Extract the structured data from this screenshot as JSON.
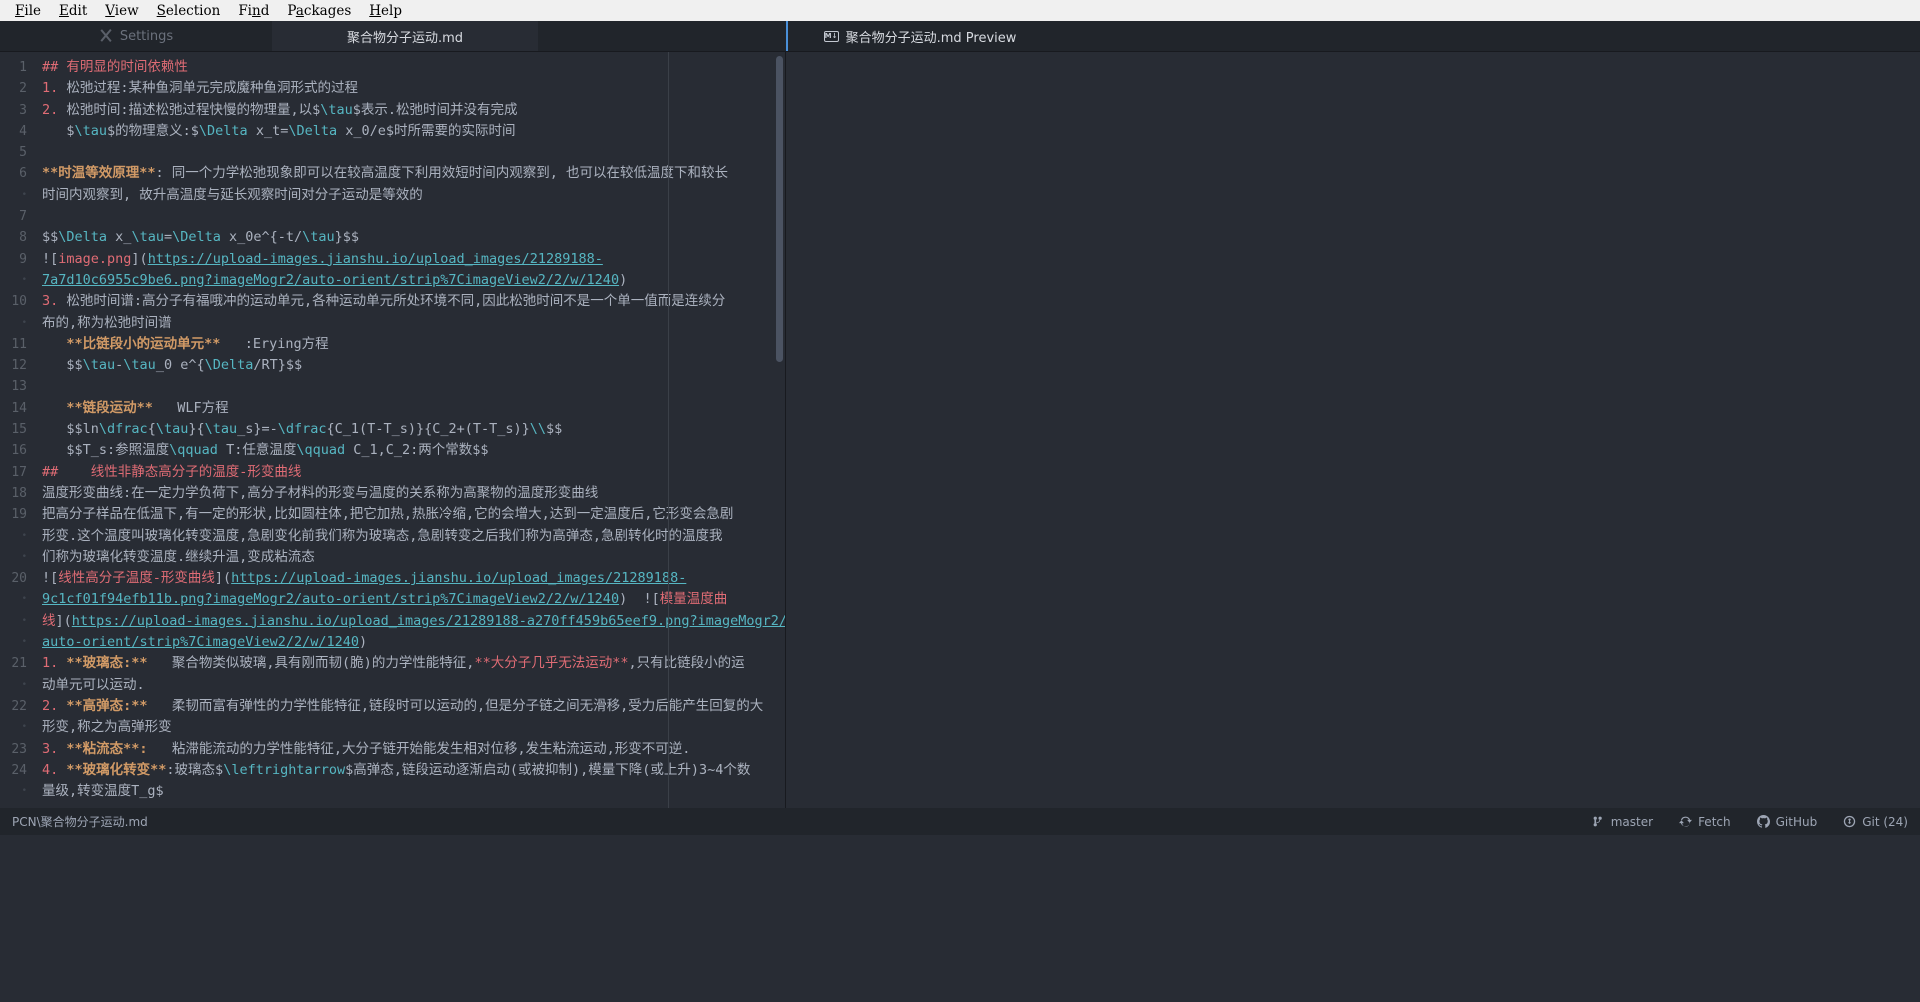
{
  "menubar": {
    "items": [
      {
        "pre": "",
        "mn": "F",
        "post": "ile"
      },
      {
        "pre": "",
        "mn": "E",
        "post": "dit"
      },
      {
        "pre": "",
        "mn": "V",
        "post": "iew"
      },
      {
        "pre": "",
        "mn": "S",
        "post": "election"
      },
      {
        "pre": "Fi",
        "mn": "n",
        "post": "d"
      },
      {
        "pre": "P",
        "mn": "a",
        "post": "ckages"
      },
      {
        "pre": "",
        "mn": "H",
        "post": "elp"
      }
    ]
  },
  "tabs": {
    "settings": {
      "label": "Settings",
      "icon": "wrench-icon"
    },
    "document": {
      "label": "聚合物分子运动.md"
    },
    "preview": {
      "label": "聚合物分子运动.md Preview",
      "icon": "markdown-icon",
      "badge": "M↓"
    }
  },
  "editor": {
    "lines": [
      {
        "num": "1",
        "soft": false,
        "segments": [
          {
            "t": "## ",
            "c": "c-head"
          },
          {
            "t": "有明显的时间依赖性",
            "c": "c-head"
          }
        ]
      },
      {
        "num": "2",
        "soft": false,
        "segments": [
          {
            "t": "1.",
            "c": "c-num"
          },
          {
            "t": " 松弛过程:某种鱼洞单元完成魔种鱼洞形式的过程",
            "c": "c-text"
          }
        ]
      },
      {
        "num": "3",
        "soft": false,
        "segments": [
          {
            "t": "2.",
            "c": "c-num"
          },
          {
            "t": " 松弛时间:描述松弛过程快慢的物理量,以$",
            "c": "c-text"
          },
          {
            "t": "\\tau",
            "c": "c-esc"
          },
          {
            "t": "$表示.松弛时间并没有完成",
            "c": "c-text"
          }
        ]
      },
      {
        "num": "4",
        "soft": false,
        "segments": [
          {
            "t": "   $",
            "c": "c-text"
          },
          {
            "t": "\\tau",
            "c": "c-esc"
          },
          {
            "t": "$的物理意义:$",
            "c": "c-text"
          },
          {
            "t": "\\Delta",
            "c": "c-esc"
          },
          {
            "t": " x_t=",
            "c": "c-text"
          },
          {
            "t": "\\Delta",
            "c": "c-esc"
          },
          {
            "t": " x_0/e$时所需要的实际时间",
            "c": "c-text"
          }
        ]
      },
      {
        "num": "5",
        "soft": false,
        "segments": []
      },
      {
        "num": "6",
        "soft": false,
        "segments": [
          {
            "t": "**时温等效原理**",
            "c": "c-bold"
          },
          {
            "t": ": 同一个力学松弛现象即可以在较高温度下利用效短时间内观察到, 也可以在较低温度下和较长",
            "c": "c-text"
          }
        ]
      },
      {
        "num": "•",
        "soft": true,
        "segments": [
          {
            "t": "时间内观察到, 故升高温度与延长观察时间对分子运动是等效的",
            "c": "c-text"
          }
        ]
      },
      {
        "num": "7",
        "soft": false,
        "segments": []
      },
      {
        "num": "8",
        "soft": false,
        "segments": [
          {
            "t": "$$",
            "c": "c-text"
          },
          {
            "t": "\\Delta",
            "c": "c-esc"
          },
          {
            "t": " x_",
            "c": "c-text"
          },
          {
            "t": "\\tau",
            "c": "c-esc"
          },
          {
            "t": "=",
            "c": "c-text"
          },
          {
            "t": "\\Delta",
            "c": "c-esc"
          },
          {
            "t": " x_0e^{-t/",
            "c": "c-text"
          },
          {
            "t": "\\tau",
            "c": "c-esc"
          },
          {
            "t": "}$$",
            "c": "c-text"
          }
        ]
      },
      {
        "num": "9",
        "soft": false,
        "segments": [
          {
            "t": "![",
            "c": "c-punct"
          },
          {
            "t": "image.png",
            "c": "c-linktxt"
          },
          {
            "t": "](",
            "c": "c-punct"
          },
          {
            "t": "https://upload-images.jianshu.io/upload_images/21289188-",
            "c": "c-link"
          }
        ]
      },
      {
        "num": "•",
        "soft": true,
        "segments": [
          {
            "t": "7a7d10c6955c9be6.png?imageMogr2/auto-orient/strip%7CimageView2/2/w/1240",
            "c": "c-link"
          },
          {
            "t": ")",
            "c": "c-punct"
          }
        ]
      },
      {
        "num": "10",
        "soft": false,
        "segments": [
          {
            "t": "3.",
            "c": "c-num"
          },
          {
            "t": " 松弛时间谱:高分子有福哦冲的运动单元,各种运动单元所处环境不同,因此松弛时间不是一个单一值而是连续分",
            "c": "c-text"
          }
        ]
      },
      {
        "num": "•",
        "soft": true,
        "segments": [
          {
            "t": "布的,称为松弛时间谱",
            "c": "c-text"
          }
        ]
      },
      {
        "num": "11",
        "soft": false,
        "segments": [
          {
            "t": "   **比链段小的运动单元**",
            "c": "c-bold"
          },
          {
            "t": "   :Erying方程",
            "c": "c-text"
          }
        ]
      },
      {
        "num": "12",
        "soft": false,
        "segments": [
          {
            "t": "   $$",
            "c": "c-text"
          },
          {
            "t": "\\tau",
            "c": "c-esc"
          },
          {
            "t": "-",
            "c": "c-text"
          },
          {
            "t": "\\tau",
            "c": "c-esc"
          },
          {
            "t": "_0 e^{",
            "c": "c-text"
          },
          {
            "t": "\\Delta",
            "c": "c-esc"
          },
          {
            "t": "/RT}$$",
            "c": "c-text"
          }
        ]
      },
      {
        "num": "13",
        "soft": false,
        "segments": []
      },
      {
        "num": "14",
        "soft": false,
        "segments": [
          {
            "t": "   **链段运动**",
            "c": "c-bold"
          },
          {
            "t": "   WLF方程",
            "c": "c-text"
          }
        ]
      },
      {
        "num": "15",
        "soft": false,
        "segments": [
          {
            "t": "   $$ln",
            "c": "c-text"
          },
          {
            "t": "\\dfrac",
            "c": "c-esc"
          },
          {
            "t": "{",
            "c": "c-text"
          },
          {
            "t": "\\tau",
            "c": "c-esc"
          },
          {
            "t": "}{",
            "c": "c-text"
          },
          {
            "t": "\\tau",
            "c": "c-esc"
          },
          {
            "t": "_s}=-",
            "c": "c-text"
          },
          {
            "t": "\\dfrac",
            "c": "c-esc"
          },
          {
            "t": "{C_1(T-T_s)}{C_2+(T-T_s)}",
            "c": "c-text"
          },
          {
            "t": "\\\\",
            "c": "c-esc"
          },
          {
            "t": "$$",
            "c": "c-text"
          }
        ]
      },
      {
        "num": "16",
        "soft": false,
        "segments": [
          {
            "t": "   $$T_s:参照温度",
            "c": "c-text"
          },
          {
            "t": "\\qquad",
            "c": "c-esc"
          },
          {
            "t": " T:任意温度",
            "c": "c-text"
          },
          {
            "t": "\\qquad",
            "c": "c-esc"
          },
          {
            "t": " C_1,C_2:两个常数$$",
            "c": "c-text"
          }
        ]
      },
      {
        "num": "17",
        "soft": false,
        "segments": [
          {
            "t": "##",
            "c": "c-head"
          },
          {
            "t": "    线性非静态高分子的温度-形变曲线",
            "c": "c-head"
          }
        ]
      },
      {
        "num": "18",
        "soft": false,
        "segments": [
          {
            "t": "温度形变曲线:在一定力学负荷下,高分子材料的形变与温度的关系称为高聚物的温度形变曲线",
            "c": "c-text"
          }
        ]
      },
      {
        "num": "19",
        "soft": false,
        "segments": [
          {
            "t": "把高分子样品在低温下,有一定的形状,比如圆柱体,把它加热,热胀冷缩,它的会增大,达到一定温度后,它形变会急剧",
            "c": "c-text"
          }
        ]
      },
      {
        "num": "•",
        "soft": true,
        "segments": [
          {
            "t": "形变.这个温度叫玻璃化转变温度,急剧变化前我们称为玻璃态,急剧转变之后我们称为高弹态,急剧转化时的温度我",
            "c": "c-text"
          }
        ]
      },
      {
        "num": "•",
        "soft": true,
        "segments": [
          {
            "t": "们称为玻璃化转变温度.继续升温,变成粘流态",
            "c": "c-text"
          }
        ]
      },
      {
        "num": "20",
        "soft": false,
        "segments": [
          {
            "t": "![",
            "c": "c-punct"
          },
          {
            "t": "线性高分子温度-形变曲线",
            "c": "c-linktxt"
          },
          {
            "t": "](",
            "c": "c-punct"
          },
          {
            "t": "https://upload-images.jianshu.io/upload_images/21289188-",
            "c": "c-link"
          }
        ]
      },
      {
        "num": "•",
        "soft": true,
        "segments": [
          {
            "t": "9c1cf01f94efb11b.png?imageMogr2/auto-orient/strip%7CimageView2/2/w/1240",
            "c": "c-link"
          },
          {
            "t": ")",
            "c": "c-punct"
          },
          {
            "t": "  ![",
            "c": "c-punct"
          },
          {
            "t": "模量温度曲",
            "c": "c-linktxt"
          }
        ]
      },
      {
        "num": "•",
        "soft": true,
        "segments": [
          {
            "t": "线",
            "c": "c-linktxt"
          },
          {
            "t": "](",
            "c": "c-punct"
          },
          {
            "t": "https://upload-images.jianshu.io/upload_images/21289188-a270ff459b65eef9.png?imageMogr2/",
            "c": "c-link"
          }
        ]
      },
      {
        "num": "•",
        "soft": true,
        "segments": [
          {
            "t": "auto-orient/strip%7CimageView2/2/w/1240",
            "c": "c-link"
          },
          {
            "t": ")",
            "c": "c-punct"
          }
        ]
      },
      {
        "num": "21",
        "soft": false,
        "segments": [
          {
            "t": "1.",
            "c": "c-num"
          },
          {
            "t": " ",
            "c": "c-text"
          },
          {
            "t": "**玻璃态:**",
            "c": "c-bold"
          },
          {
            "t": "   聚合物类似玻璃,具有刚而韧(脆)的力学性能特征,",
            "c": "c-text"
          },
          {
            "t": "**大分子几乎无法运动**",
            "c": "c-head"
          },
          {
            "t": ",只有比链段小的运",
            "c": "c-text"
          }
        ]
      },
      {
        "num": "•",
        "soft": true,
        "segments": [
          {
            "t": "动单元可以运动.",
            "c": "c-text"
          }
        ]
      },
      {
        "num": "22",
        "soft": false,
        "segments": [
          {
            "t": "2.",
            "c": "c-num"
          },
          {
            "t": " ",
            "c": "c-text"
          },
          {
            "t": "**高弹态:**",
            "c": "c-bold"
          },
          {
            "t": "   柔韧而富有弹性的力学性能特征,链段时可以运动的,但是分子链之间无滑移,受力后能产生回复的大",
            "c": "c-text"
          }
        ]
      },
      {
        "num": "•",
        "soft": true,
        "segments": [
          {
            "t": "形变,称之为高弹形变",
            "c": "c-text"
          }
        ]
      },
      {
        "num": "23",
        "soft": false,
        "segments": [
          {
            "t": "3.",
            "c": "c-num"
          },
          {
            "t": " ",
            "c": "c-text"
          },
          {
            "t": "**粘流态**:",
            "c": "c-bold"
          },
          {
            "t": "   粘滞能流动的力学性能特征,大分子链开始能发生相对位移,发生粘流运动,形变不可逆.",
            "c": "c-text"
          }
        ]
      },
      {
        "num": "24",
        "soft": false,
        "segments": [
          {
            "t": "4.",
            "c": "c-num"
          },
          {
            "t": " ",
            "c": "c-text"
          },
          {
            "t": "**玻璃化转变**",
            "c": "c-bold"
          },
          {
            "t": ":玻璃态$",
            "c": "c-text"
          },
          {
            "t": "\\leftrightarrow",
            "c": "c-esc"
          },
          {
            "t": "$高弹态,链段运动逐渐启动(或被抑制),模量下降(或上升)3~4个数",
            "c": "c-text"
          }
        ]
      },
      {
        "num": "•",
        "soft": true,
        "segments": [
          {
            "t": "量级,转变温度T_g$",
            "c": "c-text"
          }
        ]
      }
    ]
  },
  "statusbar": {
    "file_path": "PCN\\聚合物分子运动.md",
    "items": [
      {
        "label": "master",
        "icon": "branch-icon"
      },
      {
        "label": "Fetch",
        "icon": "sync-icon"
      },
      {
        "label": "GitHub",
        "icon": "github-icon"
      },
      {
        "label": "Git (24)",
        "icon": "git-icon"
      }
    ]
  },
  "colors": {
    "background": "#282c34",
    "chrome": "#21252b",
    "accent": "#4a90d9",
    "heading": "#e06c75",
    "bold": "#d19a66",
    "link": "#56b6c2",
    "text": "#abb2bf"
  }
}
